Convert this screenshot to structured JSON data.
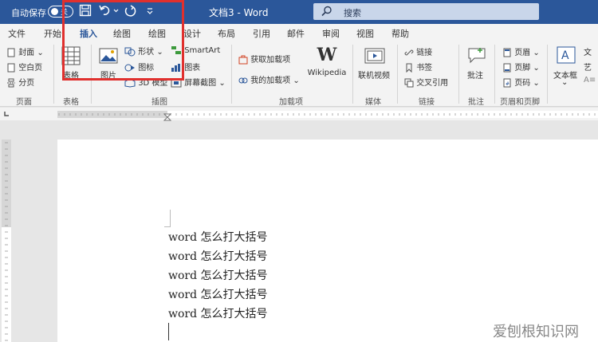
{
  "titlebar": {
    "autosave_label": "自动保存",
    "toggle_state": "关",
    "doc_title": "文档3 - Word",
    "search_placeholder": "搜索"
  },
  "tabs": [
    "文件",
    "开始",
    "插入",
    "绘图",
    "绘图",
    "设计",
    "布局",
    "引用",
    "邮件",
    "审阅",
    "视图",
    "帮助"
  ],
  "active_tab": "插入",
  "ribbon": {
    "page_group": {
      "cover": "封面",
      "blank": "空白页",
      "break": "分页",
      "label": "页面"
    },
    "table_group": {
      "table": "表格",
      "label": "表格"
    },
    "illustrations": {
      "picture": "图片",
      "shapes": "形状",
      "icons": "图标",
      "model": "3D 模型",
      "smartart": "SmartArt",
      "chart": "图表",
      "screenshot": "屏幕截图",
      "label": "插图"
    },
    "addins": {
      "get": "获取加载项",
      "my": "我的加载项",
      "wikipedia": "Wikipedia",
      "label": "加载项"
    },
    "media": {
      "video": "联机视频",
      "label": "媒体"
    },
    "links": {
      "link": "链接",
      "bookmark": "书签",
      "cross_ref": "交叉引用",
      "label": "链接"
    },
    "comments": {
      "comment": "批注",
      "label": "批注"
    },
    "header_footer": {
      "header": "页眉",
      "footer": "页脚",
      "page_num": "页码",
      "label": "页眉和页脚"
    },
    "text": {
      "textbox": "文本框",
      "partial1": "文",
      "partial2": "艺"
    }
  },
  "document": {
    "lines": [
      "word 怎么打大括号",
      "word 怎么打大括号",
      "word 怎么打大括号",
      "word 怎么打大括号",
      "word 怎么打大括号"
    ]
  },
  "watermark": "爱刨根知识网",
  "colors": {
    "accent": "#2b579a",
    "highlight": "#e0302e"
  }
}
